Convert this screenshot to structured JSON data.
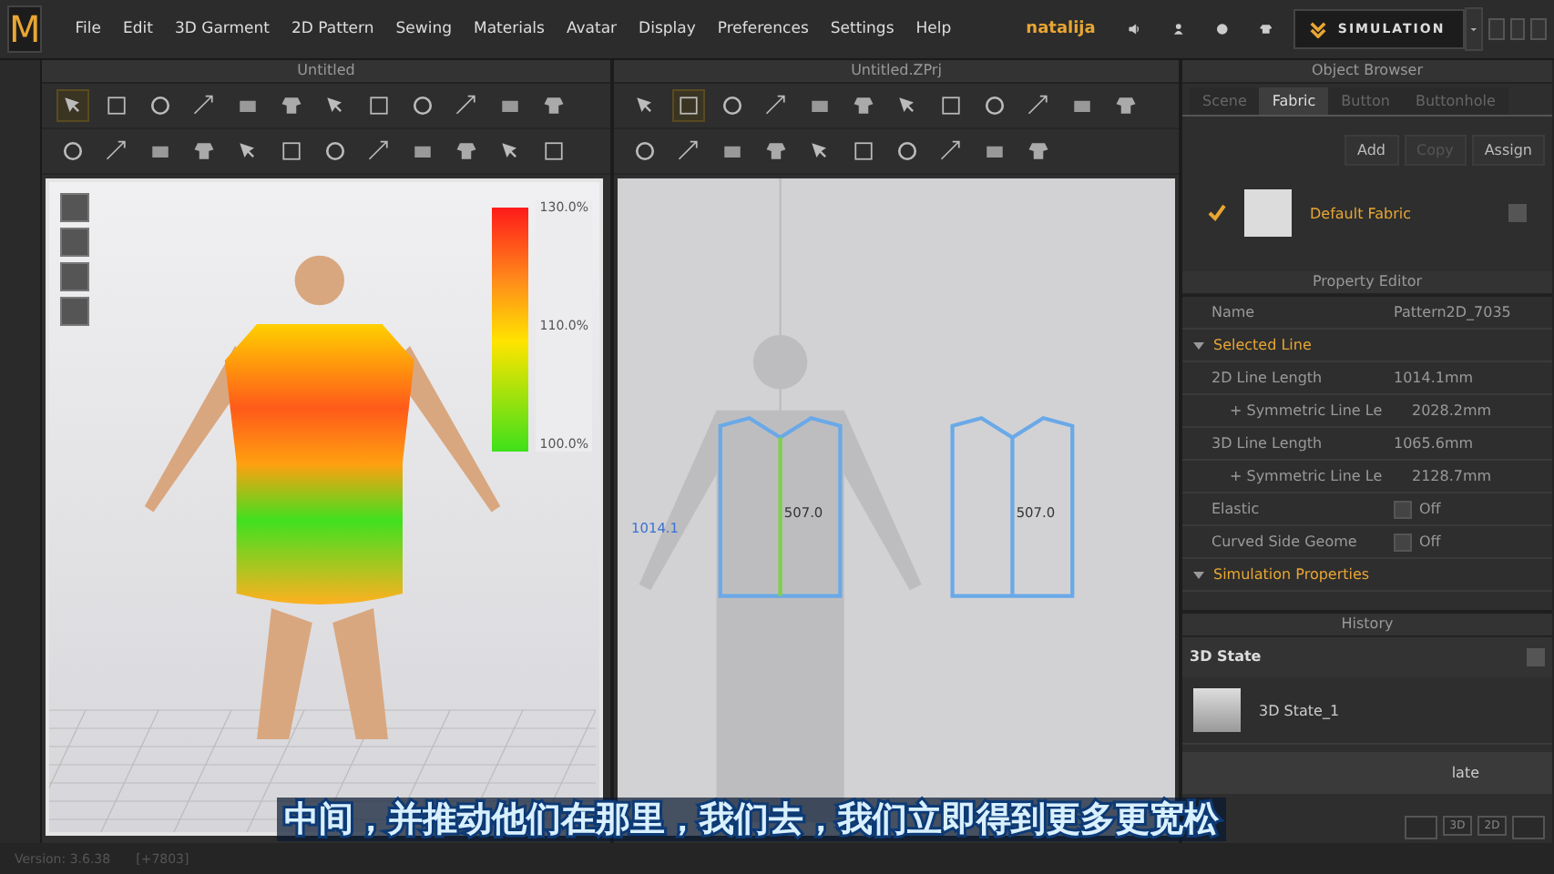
{
  "menu_bar": {
    "logo": "M",
    "items": [
      "File",
      "Edit",
      "3D Garment",
      "2D Pattern",
      "Sewing",
      "Materials",
      "Avatar",
      "Display",
      "Preferences",
      "Settings",
      "Help"
    ],
    "user": "natalija",
    "mode_button": "SIMULATION"
  },
  "panel_3d": {
    "title": "Untitled",
    "toolbar_rows": [
      [
        {
          "selected": true
        },
        {
          "selected": false
        },
        {
          "selected": false
        },
        {
          "selected": false
        },
        {
          "selected": false
        },
        {
          "selected": false
        },
        {
          "selected": false
        },
        {
          "selected": false
        },
        {
          "selected": false
        },
        {
          "selected": false
        },
        {
          "selected": false
        },
        {
          "selected": false
        }
      ],
      [
        {
          "selected": false
        },
        {
          "selected": false
        },
        {
          "selected": false
        },
        {
          "selected": false
        },
        {
          "selected": false
        },
        {
          "selected": false
        },
        {
          "selected": false
        },
        {
          "selected": false
        },
        {
          "selected": false
        },
        {
          "selected": false
        },
        {
          "selected": false
        },
        {
          "selected": false
        }
      ]
    ],
    "legend": [
      "130.0%",
      "110.0%",
      "100.0%"
    ]
  },
  "panel_2d": {
    "title": "Untitled.ZPrj",
    "toolbar_rows": [
      [
        {
          "selected": false
        },
        {
          "selected": true
        },
        {
          "selected": false
        },
        {
          "selected": false
        },
        {
          "selected": false
        },
        {
          "selected": false
        },
        {
          "selected": false
        },
        {
          "selected": false
        },
        {
          "selected": false
        },
        {
          "selected": false
        },
        {
          "selected": false
        },
        {
          "selected": false
        }
      ],
      [
        {
          "selected": false
        },
        {
          "selected": false
        },
        {
          "selected": false
        },
        {
          "selected": false
        },
        {
          "selected": false
        },
        {
          "selected": false
        },
        {
          "selected": false
        },
        {
          "selected": false
        },
        {
          "selected": false
        },
        {
          "selected": false
        }
      ]
    ],
    "measurements": [
      "507.0",
      "507.0",
      "1014.1"
    ]
  },
  "object_browser": {
    "title": "Object Browser",
    "tabs": [
      {
        "label": "Scene",
        "selected": false
      },
      {
        "label": "Fabric",
        "selected": true
      },
      {
        "label": "Button",
        "selected": false
      },
      {
        "label": "Buttonhole",
        "selected": false
      }
    ],
    "buttons": [
      {
        "label": "Add",
        "disabled": false
      },
      {
        "label": "Copy",
        "disabled": true
      },
      {
        "label": "Assign",
        "disabled": false
      }
    ],
    "fabrics": [
      {
        "name": "Default Fabric",
        "checked": true
      }
    ]
  },
  "property_editor": {
    "title": "Property Editor",
    "rows": [
      {
        "kind": "value",
        "label": "Name",
        "value": "Pattern2D_7035"
      },
      {
        "kind": "section",
        "label": "Selected Line",
        "expanded": true
      },
      {
        "kind": "value",
        "label": "2D Line Length",
        "value": "1014.1mm"
      },
      {
        "kind": "sub",
        "label": "+ Symmetric Line Le",
        "value": "2028.2mm"
      },
      {
        "kind": "value",
        "label": "3D Line Length",
        "value": "1065.6mm"
      },
      {
        "kind": "sub",
        "label": "+ Symmetric Line Le",
        "value": "2128.7mm"
      },
      {
        "kind": "toggle",
        "label": "Elastic",
        "value": "Off",
        "checked": false
      },
      {
        "kind": "toggle",
        "label": "Curved Side Geome",
        "value": "Off",
        "checked": false
      },
      {
        "kind": "section",
        "label": "Simulation Properties",
        "expanded": true
      }
    ]
  },
  "history": {
    "title": "History",
    "group": "3D State",
    "items": [
      "3D State_1"
    ],
    "next_item": "late"
  },
  "view_buttons": [
    "3D",
    "2D"
  ],
  "status_bar": {
    "version": "Version: 3.6.38",
    "info": "[+7803]"
  },
  "subtitle": "中间，并推动他们在那里，我们去，我们立即得到更多更宽松"
}
